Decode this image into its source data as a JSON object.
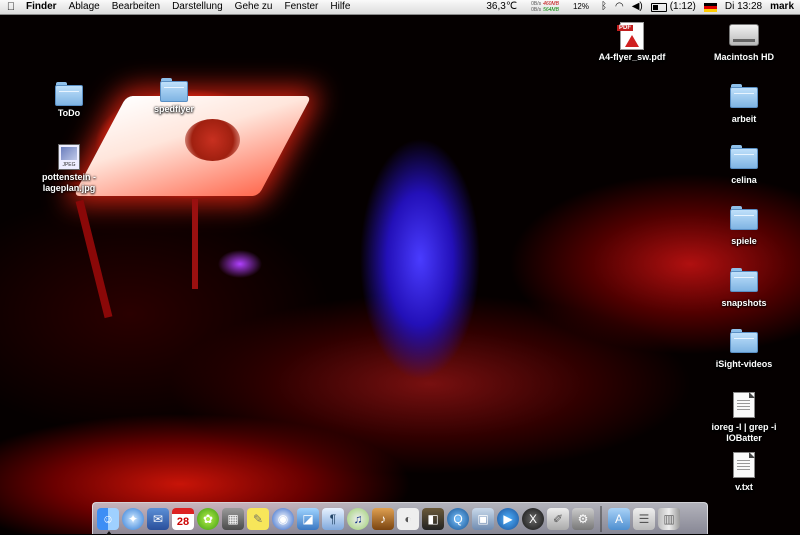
{
  "menubar": {
    "apple_icon": "apple-icon",
    "app_name": "Finder",
    "menus": [
      "Ablage",
      "Bearbeiten",
      "Darstellung",
      "Gehe zu",
      "Fenster",
      "Hilfe"
    ],
    "temperature": "36,3℃",
    "net_in": "0B/s",
    "net_out": "0B/s",
    "mem_used": "460MB",
    "mem_free": "564MB",
    "cpu": "12%",
    "battery_time": "(1:12)",
    "clock": "Di 13:28",
    "user": "mark"
  },
  "desktop": {
    "todo": "ToDo",
    "spedflyer": "spedflyer",
    "pottenstein": "pottenstein - lageplan.jpg",
    "pdf": "A4-flyer_sw.pdf",
    "macintosh_hd": "Macintosh HD",
    "arbeit": "arbeit",
    "celina": "celina",
    "spiele": "spiele",
    "snapshots": "snapshots",
    "isight": "iSight-videos",
    "ioreg": "ioreg -l | grep -i IOBatter",
    "vtxt": "v.txt"
  },
  "dock": {
    "apps": [
      "finder",
      "safari",
      "mail",
      "ical",
      "icq",
      "calculator",
      "stickies",
      "itunes-logo",
      "preview",
      "textedit",
      "itunes",
      "garageband",
      "photo-booth",
      "iphoto",
      "quicktime",
      "image-capture",
      "dvd-player",
      "x11",
      "script-editor",
      "system-preferences"
    ],
    "right": [
      "applications-folder",
      "documents",
      "trash"
    ]
  }
}
